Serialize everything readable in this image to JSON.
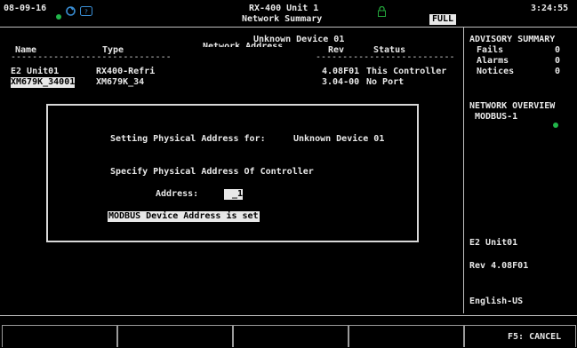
{
  "topbar": {
    "date": "08-09-16",
    "title": "RX-400 Unit 1",
    "subtitle": "Network Summary",
    "mode_badge": "FULL",
    "time": "3:24:55",
    "colors": {
      "status_green": "#21b54a",
      "icon_blue": "#3a8fd6",
      "lock_green": "#23a33a"
    },
    "icons": [
      "status-dot-icon",
      "network-icon",
      "help-icon",
      "lock-icon"
    ]
  },
  "main": {
    "device_header": "Unknown Device 01",
    "columns": {
      "name": "Name",
      "type": "Type",
      "network_address": "Network Address",
      "rev": "Rev",
      "status": "Status"
    },
    "separator_left": "------------------------------",
    "separator_right": "--------------------------",
    "rows": [
      {
        "name": "E2 Unit01",
        "type": "RX400-Refri",
        "rev": "4.08F01",
        "status": "This Controller"
      },
      {
        "name": "XM679K_34001",
        "type": "XM679K_34",
        "rev": "3.04-00",
        "status": "No Port"
      }
    ]
  },
  "modal": {
    "setting_label": "Setting Physical Address for:",
    "device_name": "Unknown Device 01",
    "instruction": "Specify Physical Address Of Controller",
    "address_label": "Address:",
    "address_value": "_1",
    "status_message": "MODBUS Device Address is set"
  },
  "sidebar": {
    "advisory_title": "ADVISORY SUMMARY",
    "advisories": [
      {
        "label": "Fails",
        "count": "0"
      },
      {
        "label": "Alarms",
        "count": "0"
      },
      {
        "label": "Notices",
        "count": "0"
      }
    ],
    "network_title": "NETWORK OVERVIEW",
    "network_item": "MODBUS-1",
    "unit_name": "E2 Unit01",
    "revision": "Rev 4.08F01",
    "language": "English-US"
  },
  "footer": {
    "f5_label": "F5: CANCEL"
  }
}
